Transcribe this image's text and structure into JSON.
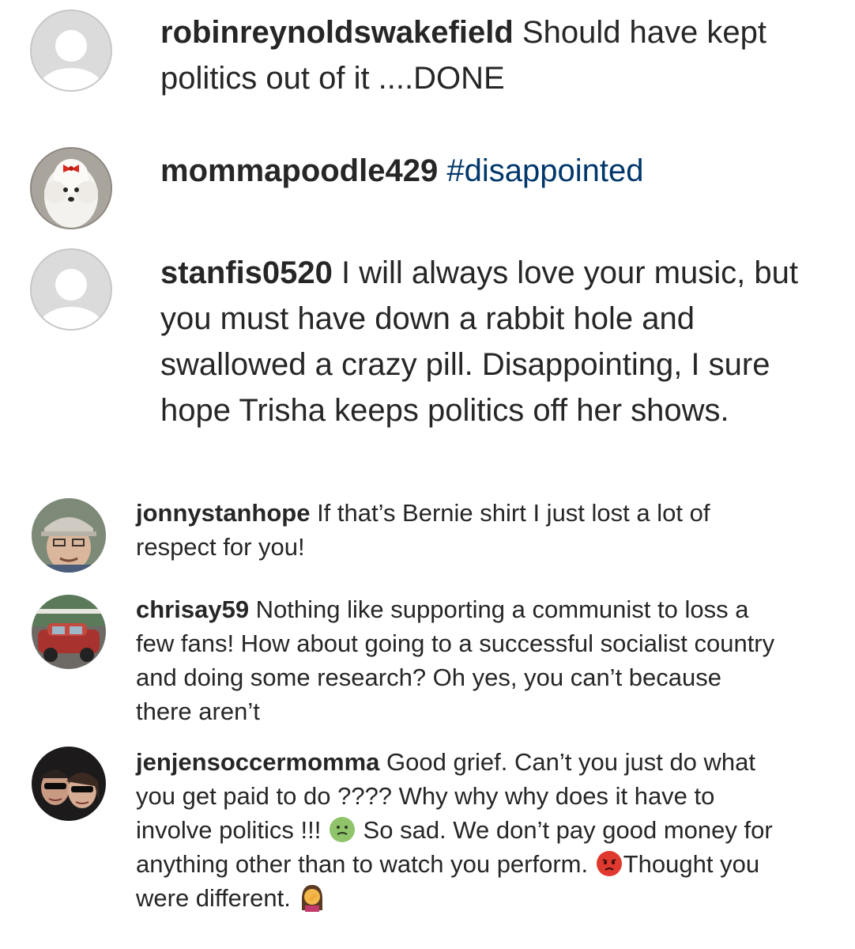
{
  "comments": [
    {
      "username": "robinreynoldswakefield",
      "text": " Should have kept politics out of it ....DONE",
      "avatar": "default-avatar"
    },
    {
      "username": "mommapoodle429",
      "hashtag": " #disappointed",
      "avatar": "poodle-photo-avatar"
    },
    {
      "username": "stanfis0520",
      "text": " I will always love your music, but you must have down a rabbit hole and swallowed a crazy pill. Disappointing, I sure hope Trisha keeps politics off her shows.",
      "avatar": "default-avatar"
    },
    {
      "username": "jonnystanhope",
      "text": " If that’s Bernie shirt I just lost a lot of respect for you!",
      "avatar": "man-with-cap-photo-avatar"
    },
    {
      "username": "chrisay59",
      "text": " Nothing like supporting a communist to loss a few fans! How about going to a successful socialist country and doing some research? Oh yes, you can’t because there aren’t",
      "avatar": "vintage-car-photo-avatar"
    },
    {
      "username": "jenjensoccermomma",
      "text_part1": " Good grief.  Can’t you just do what you get paid to do ???? Why why why does it have to involve politics !!! ",
      "text_part2": " So sad. We don’t pay good money for anything other than to watch you perform. ",
      "text_part3": "Thought you were different. ",
      "emoji1": "nauseated-face-emoji",
      "emoji2": "pouting-face-emoji",
      "emoji3": "woman-facepalming-emoji",
      "avatar": "couple-sunglasses-photo-avatar"
    }
  ],
  "colors": {
    "text": "#262626",
    "hashtag": "#00376b",
    "default_avatar": "#dbdbdb"
  }
}
